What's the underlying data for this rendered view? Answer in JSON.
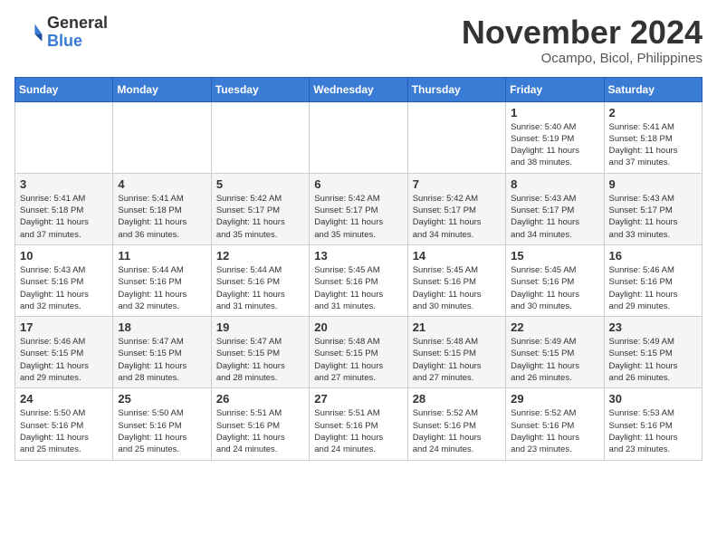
{
  "header": {
    "logo_general": "General",
    "logo_blue": "Blue",
    "month_title": "November 2024",
    "location": "Ocampo, Bicol, Philippines"
  },
  "weekdays": [
    "Sunday",
    "Monday",
    "Tuesday",
    "Wednesday",
    "Thursday",
    "Friday",
    "Saturday"
  ],
  "weeks": [
    [
      {
        "day": "",
        "info": ""
      },
      {
        "day": "",
        "info": ""
      },
      {
        "day": "",
        "info": ""
      },
      {
        "day": "",
        "info": ""
      },
      {
        "day": "",
        "info": ""
      },
      {
        "day": "1",
        "info": "Sunrise: 5:40 AM\nSunset: 5:19 PM\nDaylight: 11 hours\nand 38 minutes."
      },
      {
        "day": "2",
        "info": "Sunrise: 5:41 AM\nSunset: 5:18 PM\nDaylight: 11 hours\nand 37 minutes."
      }
    ],
    [
      {
        "day": "3",
        "info": "Sunrise: 5:41 AM\nSunset: 5:18 PM\nDaylight: 11 hours\nand 37 minutes."
      },
      {
        "day": "4",
        "info": "Sunrise: 5:41 AM\nSunset: 5:18 PM\nDaylight: 11 hours\nand 36 minutes."
      },
      {
        "day": "5",
        "info": "Sunrise: 5:42 AM\nSunset: 5:17 PM\nDaylight: 11 hours\nand 35 minutes."
      },
      {
        "day": "6",
        "info": "Sunrise: 5:42 AM\nSunset: 5:17 PM\nDaylight: 11 hours\nand 35 minutes."
      },
      {
        "day": "7",
        "info": "Sunrise: 5:42 AM\nSunset: 5:17 PM\nDaylight: 11 hours\nand 34 minutes."
      },
      {
        "day": "8",
        "info": "Sunrise: 5:43 AM\nSunset: 5:17 PM\nDaylight: 11 hours\nand 34 minutes."
      },
      {
        "day": "9",
        "info": "Sunrise: 5:43 AM\nSunset: 5:17 PM\nDaylight: 11 hours\nand 33 minutes."
      }
    ],
    [
      {
        "day": "10",
        "info": "Sunrise: 5:43 AM\nSunset: 5:16 PM\nDaylight: 11 hours\nand 32 minutes."
      },
      {
        "day": "11",
        "info": "Sunrise: 5:44 AM\nSunset: 5:16 PM\nDaylight: 11 hours\nand 32 minutes."
      },
      {
        "day": "12",
        "info": "Sunrise: 5:44 AM\nSunset: 5:16 PM\nDaylight: 11 hours\nand 31 minutes."
      },
      {
        "day": "13",
        "info": "Sunrise: 5:45 AM\nSunset: 5:16 PM\nDaylight: 11 hours\nand 31 minutes."
      },
      {
        "day": "14",
        "info": "Sunrise: 5:45 AM\nSunset: 5:16 PM\nDaylight: 11 hours\nand 30 minutes."
      },
      {
        "day": "15",
        "info": "Sunrise: 5:45 AM\nSunset: 5:16 PM\nDaylight: 11 hours\nand 30 minutes."
      },
      {
        "day": "16",
        "info": "Sunrise: 5:46 AM\nSunset: 5:16 PM\nDaylight: 11 hours\nand 29 minutes."
      }
    ],
    [
      {
        "day": "17",
        "info": "Sunrise: 5:46 AM\nSunset: 5:15 PM\nDaylight: 11 hours\nand 29 minutes."
      },
      {
        "day": "18",
        "info": "Sunrise: 5:47 AM\nSunset: 5:15 PM\nDaylight: 11 hours\nand 28 minutes."
      },
      {
        "day": "19",
        "info": "Sunrise: 5:47 AM\nSunset: 5:15 PM\nDaylight: 11 hours\nand 28 minutes."
      },
      {
        "day": "20",
        "info": "Sunrise: 5:48 AM\nSunset: 5:15 PM\nDaylight: 11 hours\nand 27 minutes."
      },
      {
        "day": "21",
        "info": "Sunrise: 5:48 AM\nSunset: 5:15 PM\nDaylight: 11 hours\nand 27 minutes."
      },
      {
        "day": "22",
        "info": "Sunrise: 5:49 AM\nSunset: 5:15 PM\nDaylight: 11 hours\nand 26 minutes."
      },
      {
        "day": "23",
        "info": "Sunrise: 5:49 AM\nSunset: 5:15 PM\nDaylight: 11 hours\nand 26 minutes."
      }
    ],
    [
      {
        "day": "24",
        "info": "Sunrise: 5:50 AM\nSunset: 5:16 PM\nDaylight: 11 hours\nand 25 minutes."
      },
      {
        "day": "25",
        "info": "Sunrise: 5:50 AM\nSunset: 5:16 PM\nDaylight: 11 hours\nand 25 minutes."
      },
      {
        "day": "26",
        "info": "Sunrise: 5:51 AM\nSunset: 5:16 PM\nDaylight: 11 hours\nand 24 minutes."
      },
      {
        "day": "27",
        "info": "Sunrise: 5:51 AM\nSunset: 5:16 PM\nDaylight: 11 hours\nand 24 minutes."
      },
      {
        "day": "28",
        "info": "Sunrise: 5:52 AM\nSunset: 5:16 PM\nDaylight: 11 hours\nand 24 minutes."
      },
      {
        "day": "29",
        "info": "Sunrise: 5:52 AM\nSunset: 5:16 PM\nDaylight: 11 hours\nand 23 minutes."
      },
      {
        "day": "30",
        "info": "Sunrise: 5:53 AM\nSunset: 5:16 PM\nDaylight: 11 hours\nand 23 minutes."
      }
    ]
  ]
}
